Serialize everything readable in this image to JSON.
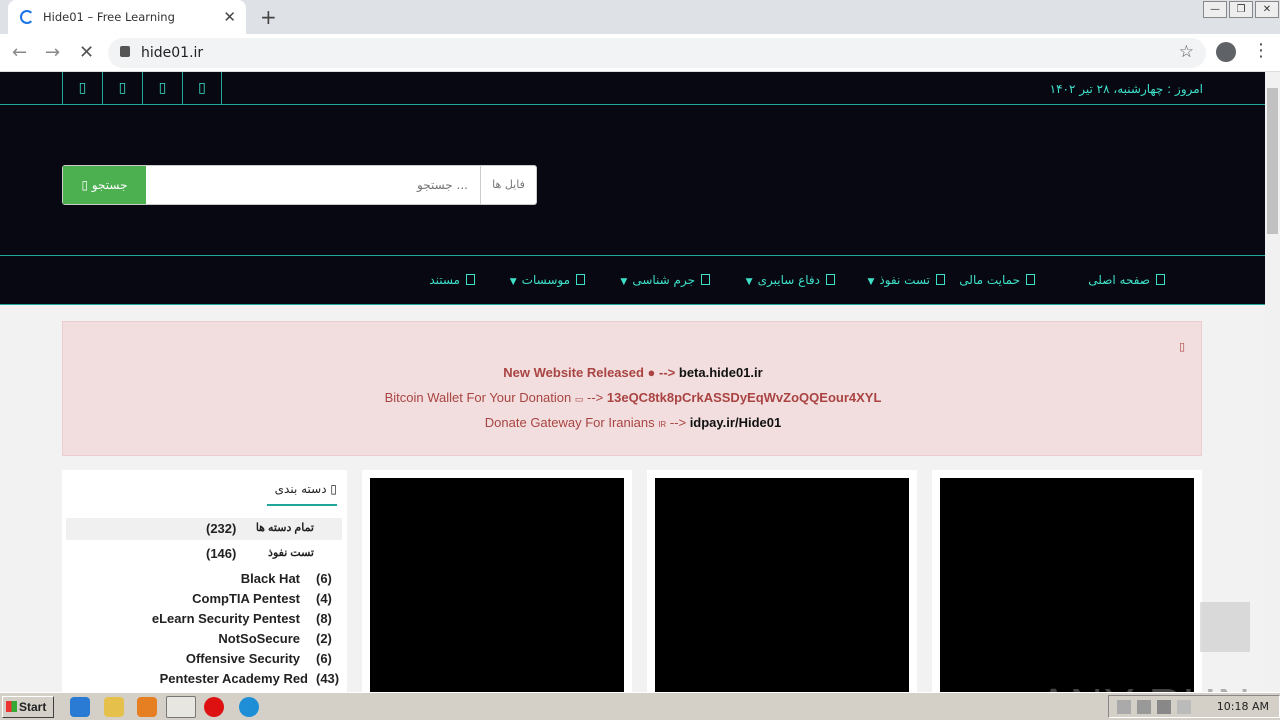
{
  "browser": {
    "tab_title": "Hide01 – Free Learning",
    "url": "hide01.ir"
  },
  "site": {
    "date": "امروز : چهارشنبه، ۲۸ تیر ۱۴۰۲",
    "search": {
      "button_label": "جستجو",
      "placeholder": "جستجو ...",
      "category": "فایل ها"
    },
    "nav": [
      {
        "label": "صفحه اصلی",
        "dropdown": false
      },
      {
        "label": "حمایت مالی",
        "dropdown": false
      },
      {
        "label": "تست نفوذ",
        "dropdown": true
      },
      {
        "label": "دفاع سایبری",
        "dropdown": true
      },
      {
        "label": "جرم شناسی",
        "dropdown": true
      },
      {
        "label": "موسسات",
        "dropdown": true
      },
      {
        "label": "مستند",
        "dropdown": false
      }
    ],
    "notice": {
      "line1_text": "New Website Released ",
      "line1_arrow": " --> ",
      "line1_link": "beta.hide01.ir",
      "line2_text": "Bitcoin Wallet For Your Donation ",
      "line2_arrow": " --> ",
      "line2_link": "13eQC8tk8pCrkASSDyEqWvZoQQEour4XYL",
      "line3_text": "Donate Gateway For Iranians ",
      "line3_flag": "IR",
      "line3_arrow": " --> ",
      "line3_link": "idpay.ir/Hide01"
    },
    "categories": {
      "title": "دسته بندی",
      "items": [
        {
          "label": "تمام دسته ها",
          "count": "(232)"
        },
        {
          "label": "تست نفوذ",
          "count": "(146)"
        },
        {
          "label": "Black Hat",
          "count": "(6)"
        },
        {
          "label": "CompTIA Pentest",
          "count": "(4)"
        },
        {
          "label": "eLearn Security Pentest",
          "count": "(8)"
        },
        {
          "label": "NotSoSecure",
          "count": "(2)"
        },
        {
          "label": "Offensive Security",
          "count": "(6)"
        },
        {
          "label": "Pentester Academy Red",
          "count": "(43)"
        }
      ]
    }
  },
  "taskbar": {
    "start_label": "Start",
    "clock": "10:18 AM"
  },
  "watermark": "ANY RUN"
}
